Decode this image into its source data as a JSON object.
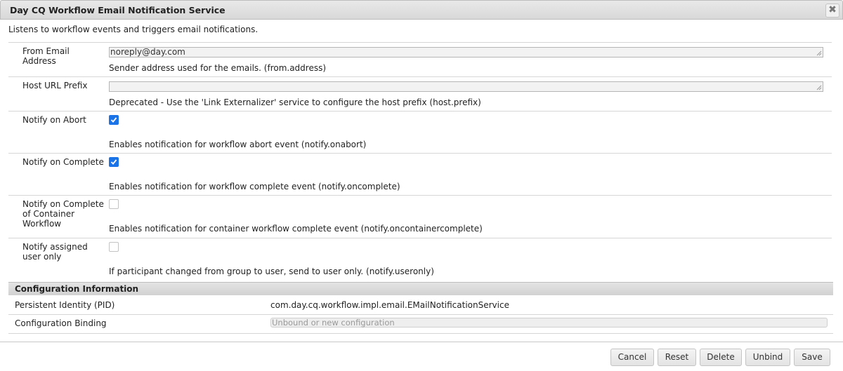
{
  "dialog": {
    "title": "Day CQ Workflow Email Notification Service",
    "close_label": "✖",
    "description": "Listens to workflow events and triggers email notifications."
  },
  "fields": [
    {
      "label": "From Email Address",
      "type": "text",
      "value": "noreply@day.com",
      "help": "Sender address used for the emails. (from.address)"
    },
    {
      "label": "Host URL Prefix",
      "type": "text",
      "value": "",
      "help": "Deprecated - Use the 'Link Externalizer' service to configure the host prefix (host.prefix)"
    },
    {
      "label": "Notify on Abort",
      "type": "checkbox",
      "checked": true,
      "help": "Enables notification for workflow abort event (notify.onabort)"
    },
    {
      "label": "Notify on Complete",
      "type": "checkbox",
      "checked": true,
      "help": "Enables notification for workflow complete event (notify.oncomplete)"
    },
    {
      "label": "Notify on Complete of Container Workflow",
      "type": "checkbox",
      "checked": false,
      "help": "Enables notification for container workflow complete event (notify.oncontainercomplete)"
    },
    {
      "label": "Notify assigned user only",
      "type": "checkbox",
      "checked": false,
      "help": "If participant changed from group to user, send to user only. (notify.useronly)"
    }
  ],
  "config_info": {
    "title": "Configuration Information",
    "pid_label": "Persistent Identity (PID)",
    "pid_value": "com.day.cq.workflow.impl.email.EMailNotificationService",
    "binding_label": "Configuration Binding",
    "binding_value": "Unbound or new configuration"
  },
  "buttons": {
    "cancel": "Cancel",
    "reset": "Reset",
    "delete": "Delete",
    "unbind": "Unbind",
    "save": "Save"
  },
  "colors": {
    "checkbox_checked": "#1b73e8",
    "header_bg": "#dddddd"
  }
}
